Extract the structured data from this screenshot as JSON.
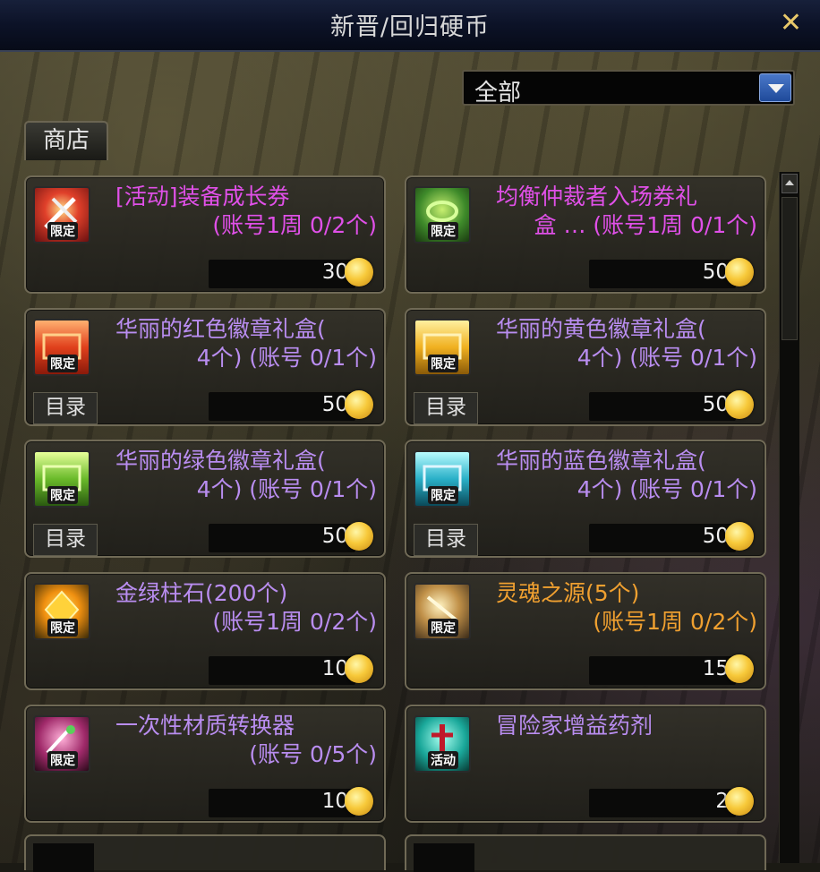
{
  "window": {
    "title": "新晋/回归硬币",
    "close_symbol": "✕"
  },
  "filter": {
    "selected": "全部"
  },
  "tab": {
    "label": "商店"
  },
  "items": [
    {
      "name": "[活动]装备成长券",
      "line2": "(账号1周 0/2个)",
      "price": "30",
      "badge": "限定",
      "color": "magenta",
      "catalog": null,
      "icon": "equipment-ticket-icon"
    },
    {
      "name": "均衡仲裁者入场券礼盒 ...",
      "line1": "均衡仲裁者入场券礼",
      "line2": "盒 …  (账号1周 0/1个)",
      "price": "50",
      "badge": "限定",
      "color": "magenta",
      "catalog": null,
      "icon": "ticket-box-icon"
    },
    {
      "name": "华丽的红色徽章礼盒(4个)",
      "line1": "华丽的红色徽章礼盒(",
      "line2": "4个)   (账号 0/1个)",
      "price": "50",
      "badge": "限定",
      "color": "purple",
      "catalog": "目录",
      "icon": "red-box-icon"
    },
    {
      "name": "华丽的黄色徽章礼盒(4个)",
      "line1": "华丽的黄色徽章礼盒(",
      "line2": "4个)   (账号 0/1个)",
      "price": "50",
      "badge": "限定",
      "color": "purple",
      "catalog": "目录",
      "icon": "yellow-box-icon"
    },
    {
      "name": "华丽的绿色徽章礼盒(4个)",
      "line1": "华丽的绿色徽章礼盒(",
      "line2": "4个)   (账号 0/1个)",
      "price": "50",
      "badge": "限定",
      "color": "purple",
      "catalog": "目录",
      "icon": "green-box-icon"
    },
    {
      "name": "华丽的蓝色徽章礼盒(4个)",
      "line1": "华丽的蓝色徽章礼盒(",
      "line2": "4个)   (账号 0/1个)",
      "price": "50",
      "badge": "限定",
      "color": "purple",
      "catalog": "目录",
      "icon": "blue-box-icon"
    },
    {
      "name": "金绿柱石(200个)",
      "line1": "金绿柱石(200个)",
      "line2": "(账号1周 0/2个)",
      "price": "10",
      "badge": "限定",
      "color": "purple",
      "catalog": null,
      "icon": "gem-icon"
    },
    {
      "name": "灵魂之源(5个)",
      "line1": "灵魂之源(5个)",
      "line2": "(账号1周 0/2个)",
      "price": "15",
      "badge": "限定",
      "color": "orange",
      "catalog": null,
      "icon": "soul-source-icon"
    },
    {
      "name": "一次性材质转换器",
      "line1": "一次性材质转换器",
      "line2": "(账号 0/5个)",
      "price": "10",
      "badge": "限定",
      "color": "purple",
      "catalog": null,
      "icon": "converter-icon"
    },
    {
      "name": "冒险家增益药剂",
      "line1": "冒险家增益药剂",
      "line2": "",
      "price": "2",
      "badge": "活动",
      "color": "purple",
      "catalog": null,
      "icon": "potion-icon"
    }
  ],
  "colors": {
    "magenta": "#e050e8",
    "purple": "#b98df0",
    "orange": "#f0a030",
    "title_bar": "#0c1227"
  }
}
